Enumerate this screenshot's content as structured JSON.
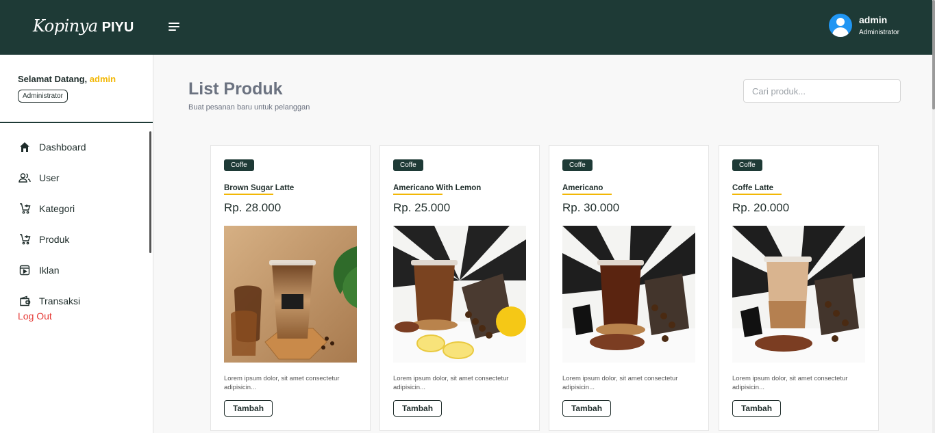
{
  "header": {
    "brand_script": "Kopinya",
    "brand_bold": "PIYU",
    "user_name": "admin",
    "user_role": "Administrator"
  },
  "sidebar": {
    "welcome_prefix": "Selamat Datang,",
    "welcome_user": "admin",
    "role_badge": "Administrator",
    "items": [
      {
        "label": "Dashboard",
        "icon": "home-icon"
      },
      {
        "label": "User",
        "icon": "users-icon"
      },
      {
        "label": "Kategori",
        "icon": "cart-add-icon"
      },
      {
        "label": "Produk",
        "icon": "cart-add-icon"
      },
      {
        "label": "Iklan",
        "icon": "video-icon"
      },
      {
        "label": "Transaksi",
        "icon": "wallet-icon"
      }
    ],
    "logout": "Log Out"
  },
  "main": {
    "title": "List Produk",
    "subtitle": "Buat pesanan baru untuk pelanggan",
    "search_placeholder": "Cari produk..."
  },
  "products": [
    {
      "category": "Coffe",
      "name": "Brown Sugar Latte",
      "price": "Rp. 28.000",
      "desc": "Lorem ipsum dolor, sit amet consectetur adipisicin...",
      "button": "Tambah"
    },
    {
      "category": "Coffe",
      "name": "Americano With Lemon",
      "price": "Rp. 25.000",
      "desc": "Lorem ipsum dolor, sit amet consectetur adipisicin...",
      "button": "Tambah"
    },
    {
      "category": "Coffe",
      "name": "Americano",
      "price": "Rp. 30.000",
      "desc": "Lorem ipsum dolor, sit amet consectetur adipisicin...",
      "button": "Tambah"
    },
    {
      "category": "Coffe",
      "name": "Coffe Latte",
      "price": "Rp. 20.000",
      "desc": "Lorem ipsum dolor, sit amet consectetur adipisicin...",
      "button": "Tambah"
    }
  ],
  "colors": {
    "header_bg": "#1e3a36",
    "accent": "#f2b705",
    "logout": "#e53935",
    "avatar": "#2196f3"
  }
}
